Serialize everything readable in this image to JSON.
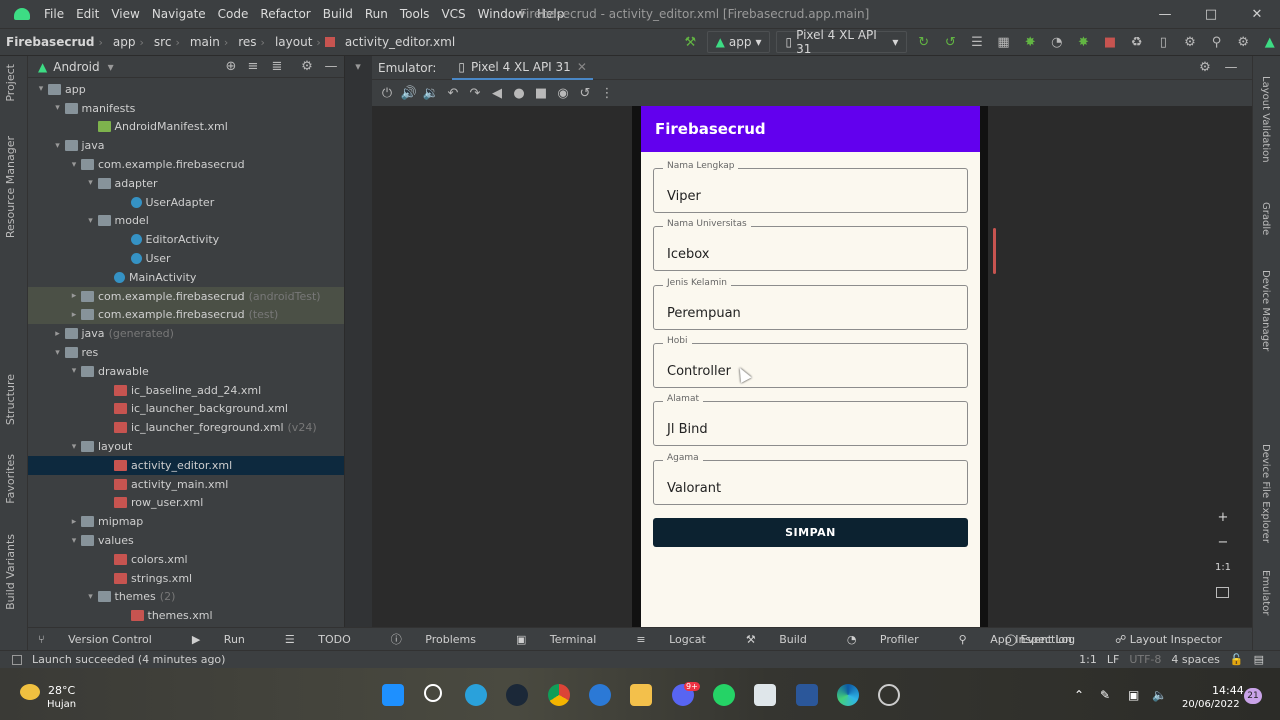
{
  "menu": [
    "File",
    "Edit",
    "View",
    "Navigate",
    "Code",
    "Refactor",
    "Build",
    "Run",
    "Tools",
    "VCS",
    "Window",
    "Help"
  ],
  "window_title": "Firebasecrud - activity_editor.xml [Firebasecrud.app.main]",
  "breadcrumb": [
    "Firebasecrud",
    "app",
    "src",
    "main",
    "res",
    "layout",
    "activity_editor.xml"
  ],
  "run_config": "app",
  "device": "Pixel 4 XL API 31",
  "project_view": "Android",
  "tree": [
    {
      "label": "app",
      "depth": 0,
      "arrow": "v",
      "icon": "fold"
    },
    {
      "label": "manifests",
      "depth": 1,
      "arrow": "v",
      "icon": "fold"
    },
    {
      "label": "AndroidManifest.xml",
      "depth": 3,
      "arrow": "",
      "icon": "mf"
    },
    {
      "label": "java",
      "depth": 1,
      "arrow": "v",
      "icon": "fold"
    },
    {
      "label": "com.example.firebasecrud",
      "depth": 2,
      "arrow": "v",
      "icon": "pkg"
    },
    {
      "label": "adapter",
      "depth": 3,
      "arrow": "v",
      "icon": "pkg"
    },
    {
      "label": "UserAdapter",
      "depth": 5,
      "arrow": "",
      "icon": "cls"
    },
    {
      "label": "model",
      "depth": 3,
      "arrow": "v",
      "icon": "pkg"
    },
    {
      "label": "EditorActivity",
      "depth": 5,
      "arrow": "",
      "icon": "cls"
    },
    {
      "label": "User",
      "depth": 5,
      "arrow": "",
      "icon": "cls"
    },
    {
      "label": "MainActivity",
      "depth": 4,
      "arrow": "",
      "icon": "cls"
    },
    {
      "label": "com.example.firebasecrud",
      "depth": 2,
      "arrow": ">",
      "icon": "pkg",
      "dim": "(androidTest)",
      "cls": "test"
    },
    {
      "label": "com.example.firebasecrud",
      "depth": 2,
      "arrow": ">",
      "icon": "pkg",
      "dim": "(test)",
      "cls": "test"
    },
    {
      "label": "java",
      "depth": 1,
      "arrow": ">",
      "icon": "fold",
      "dim": "(generated)"
    },
    {
      "label": "res",
      "depth": 1,
      "arrow": "v",
      "icon": "fold"
    },
    {
      "label": "drawable",
      "depth": 2,
      "arrow": "v",
      "icon": "fold"
    },
    {
      "label": "ic_baseline_add_24.xml",
      "depth": 4,
      "arrow": "",
      "icon": "xml"
    },
    {
      "label": "ic_launcher_background.xml",
      "depth": 4,
      "arrow": "",
      "icon": "xml"
    },
    {
      "label": "ic_launcher_foreground.xml",
      "depth": 4,
      "arrow": "",
      "icon": "xml",
      "dim": "(v24)"
    },
    {
      "label": "layout",
      "depth": 2,
      "arrow": "v",
      "icon": "fold"
    },
    {
      "label": "activity_editor.xml",
      "depth": 4,
      "arrow": "",
      "icon": "xml",
      "cls": "sel"
    },
    {
      "label": "activity_main.xml",
      "depth": 4,
      "arrow": "",
      "icon": "xml"
    },
    {
      "label": "row_user.xml",
      "depth": 4,
      "arrow": "",
      "icon": "xml"
    },
    {
      "label": "mipmap",
      "depth": 2,
      "arrow": ">",
      "icon": "fold"
    },
    {
      "label": "values",
      "depth": 2,
      "arrow": "v",
      "icon": "fold"
    },
    {
      "label": "colors.xml",
      "depth": 4,
      "arrow": "",
      "icon": "xml"
    },
    {
      "label": "strings.xml",
      "depth": 4,
      "arrow": "",
      "icon": "xml"
    },
    {
      "label": "themes",
      "depth": 3,
      "arrow": "v",
      "icon": "fold",
      "dim": "(2)"
    },
    {
      "label": "themes.xml",
      "depth": 5,
      "arrow": "",
      "icon": "xml"
    }
  ],
  "left_tabs": [
    "Project",
    "Resource Manager",
    "Structure",
    "Favorites",
    "Build Variants"
  ],
  "right_tabs": [
    "Layout Validation",
    "Gradle",
    "Device Manager",
    "Device File Explorer",
    "Emulator"
  ],
  "emulator": {
    "label": "Emulator:",
    "tab": "Pixel 4 XL API 31"
  },
  "app": {
    "title": "Firebasecrud",
    "fields": [
      {
        "label": "Nama Lengkap",
        "value": "Viper"
      },
      {
        "label": "Nama Universitas",
        "value": "Icebox"
      },
      {
        "label": "Jenis Kelamin",
        "value": "Perempuan"
      },
      {
        "label": "Hobi",
        "value": "Controller"
      },
      {
        "label": "Alamat",
        "value": "Jl Bind"
      },
      {
        "label": "Agama",
        "value": "Valorant"
      }
    ],
    "button": "SIMPAN"
  },
  "zoom": {
    "plus": "+",
    "minus": "−",
    "ratio": "1:1"
  },
  "bottom_tools": [
    "Version Control",
    "Run",
    "TODO",
    "Problems",
    "Terminal",
    "Logcat",
    "Build",
    "Profiler",
    "App Inspection"
  ],
  "bottom_right_tools": [
    "Event Log",
    "Layout Inspector"
  ],
  "status": {
    "message": "Launch succeeded (4 minutes ago)",
    "pos": "1:1",
    "lf": "LF",
    "enc": "UTF-8",
    "indent": "4 spaces"
  },
  "taskbar": {
    "temp": "28°C",
    "weather": "Hujan",
    "time": "14:44",
    "date": "20/06/2022",
    "badge": "21",
    "mail_badge": "9+"
  }
}
